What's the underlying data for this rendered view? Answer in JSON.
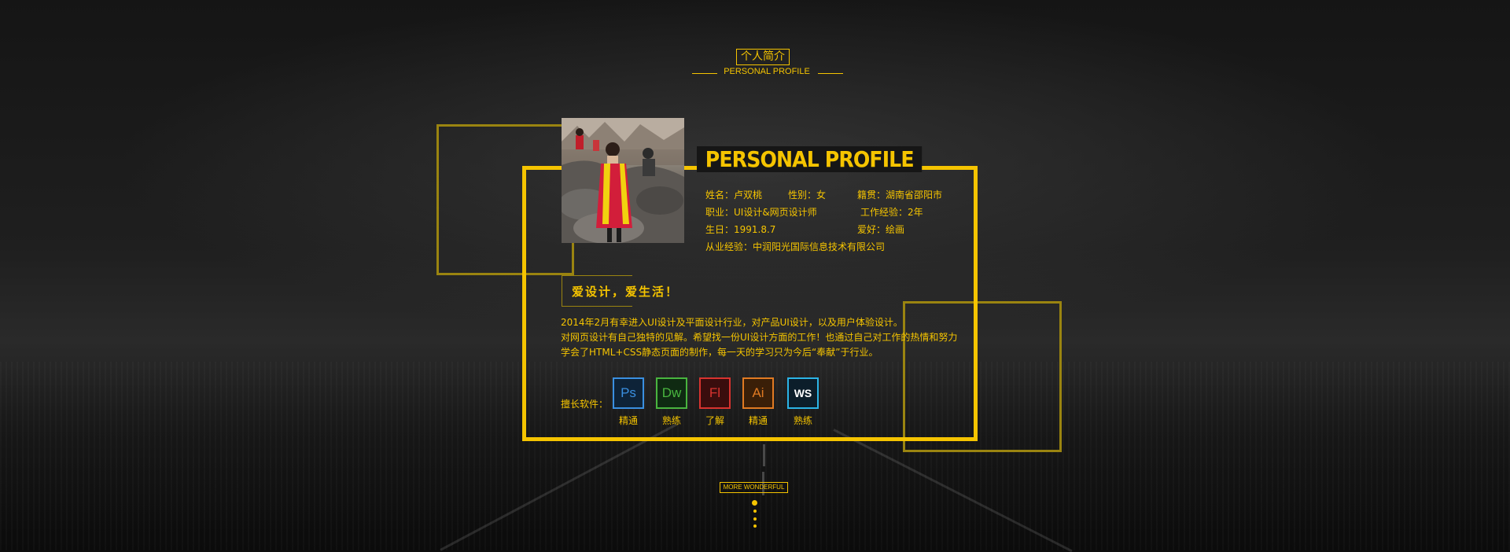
{
  "header": {
    "title": "个人简介",
    "subtitle": "PERSONAL PROFILE"
  },
  "profile": {
    "heading": "PERSONAL PROFILE",
    "name": "姓名：卢双桃",
    "gender": "性别：女",
    "hometown": "籍贯：湖南省邵阳市",
    "job": "职业：UI设计&网页设计师",
    "experience": "工作经验：2年",
    "birthday": "生日：1991.8.7",
    "hobby": "爱好：绘画",
    "company": "从业经验：中润阳光国际信息技术有限公司"
  },
  "motto": "爱设计，爱生活！",
  "intro": [
    "2014年2月有幸进入UI设计及平面设计行业，对产品UI设计，以及用户体验设计。",
    "对网页设计有自己独特的见解。希望找一份UI设计方面的工作！也通过自己对工作的热情和努力",
    "学会了HTML+CSS静态页面的制作，每一天的学习只为今后“奉献”于行业。"
  ],
  "skills": {
    "label": "擅长软件：",
    "items": [
      {
        "abbr": "Ps",
        "level": "精通",
        "color": "#3a8fe0",
        "bg": "#0e2338"
      },
      {
        "abbr": "Dw",
        "level": "熟练",
        "color": "#49b53f",
        "bg": "#0f2a12"
      },
      {
        "abbr": "Fl",
        "level": "了解",
        "color": "#d8332f",
        "bg": "#3a0d0d"
      },
      {
        "abbr": "Ai",
        "level": "精通",
        "color": "#e07a22",
        "bg": "#3a1f08"
      },
      {
        "abbr": "WS",
        "level": "熟练",
        "color": "#2bb4e6",
        "bg": "#0e2b3a"
      }
    ]
  },
  "more": "MORE WONDERFUL",
  "colors": {
    "accent": "#f5c400",
    "frame_secondary": "#9a8410",
    "background": "#121212"
  }
}
